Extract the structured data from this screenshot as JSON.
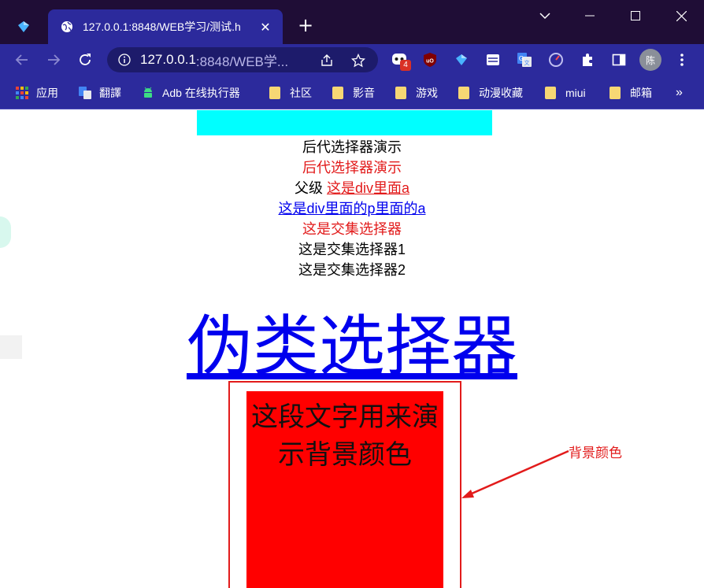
{
  "browser": {
    "tab": {
      "title": "127.0.0.1:8848/WEB学习/测试.h"
    },
    "newtab_label": "+",
    "url_host": "127.0.0.1",
    "url_path": ":8848/WEB学...",
    "badge_count": "4",
    "profile_initial": "陈",
    "close_glyph": "✕",
    "more_glyph": "»"
  },
  "bookmarks": [
    {
      "label": "应用",
      "icon": "apps-grid-icon"
    },
    {
      "label": "翻譯",
      "icon": "translate-icon"
    },
    {
      "label": "Adb 在线执行器",
      "icon": "android-icon"
    },
    {
      "label": "社区",
      "icon": "folder-icon"
    },
    {
      "label": "影音",
      "icon": "folder-icon"
    },
    {
      "label": "游戏",
      "icon": "folder-icon"
    },
    {
      "label": "动漫收藏",
      "icon": "folder-icon"
    },
    {
      "label": "miui",
      "icon": "folder-icon"
    },
    {
      "label": "邮箱",
      "icon": "folder-icon"
    }
  ],
  "page": {
    "lines": [
      "后代选择器演示",
      "后代选择器演示",
      "父级",
      "这是div里面a",
      "这是div里面的p里面的a",
      "这是交集选择器",
      "这是交集选择器1",
      "这是交集选择器2"
    ],
    "heading_link": "伪类选择器",
    "bg_text": "这段文字用来演示背景颜色",
    "annotation": "背景颜色"
  },
  "colors": {
    "frame": "#2c2a9c",
    "titlebar": "#1f0d36",
    "cyan": "#00ffff",
    "red": "#ff0000",
    "link_blue": "#0000ee",
    "annotation_red": "#e21b1b"
  }
}
